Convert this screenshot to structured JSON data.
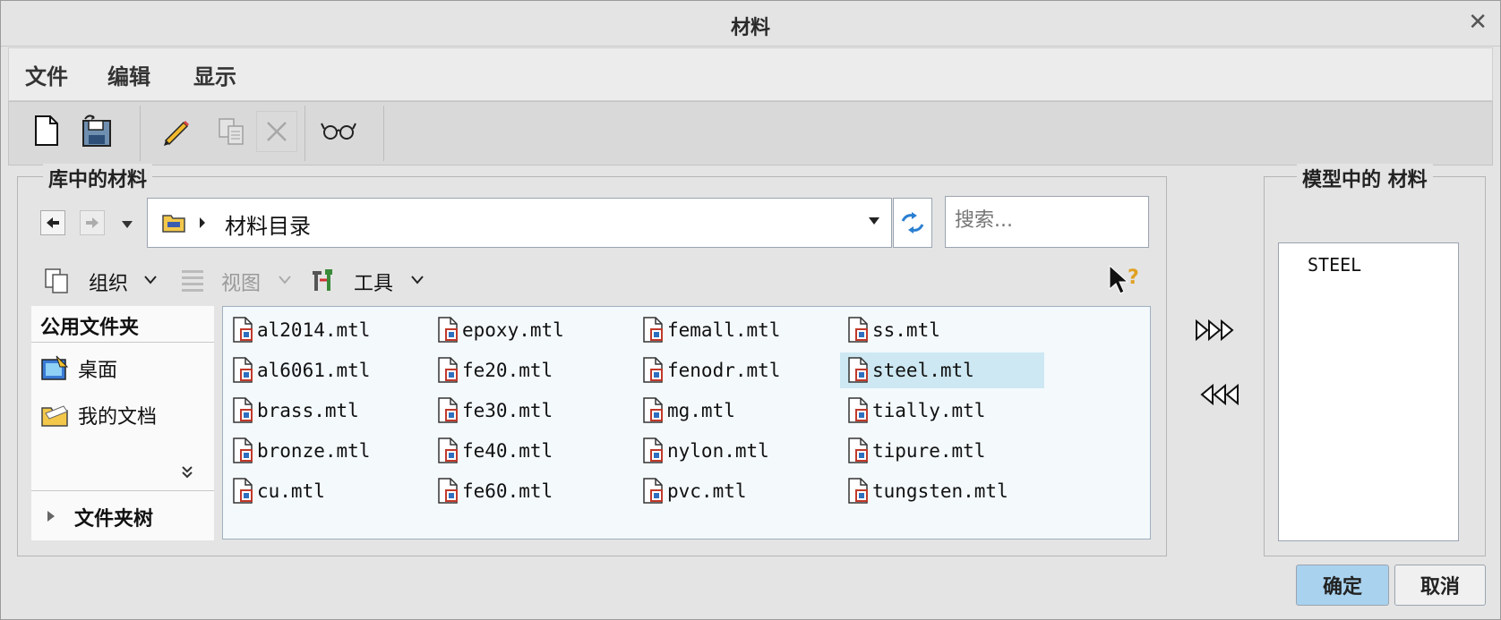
{
  "window": {
    "title": "材料"
  },
  "menu": [
    "文件",
    "编辑",
    "显示"
  ],
  "toolbar": {
    "buttons": [
      {
        "name": "new-icon",
        "enabled": true
      },
      {
        "name": "save-icon",
        "enabled": true
      },
      {
        "name": "pencil-edit-icon",
        "enabled": true
      },
      {
        "name": "copy-icon",
        "enabled": false
      },
      {
        "name": "delete-icon",
        "enabled": false
      },
      {
        "name": "glasses-view-icon",
        "enabled": true
      }
    ]
  },
  "library": {
    "legend": "库中的材料",
    "path": "材料目录",
    "search_placeholder": "搜索...",
    "organize": "组织",
    "view": "视图",
    "tools": "工具",
    "common_folders": "公用文件夹",
    "desktop": "桌面",
    "documents": "我的文档",
    "folder_tree": "文件夹树",
    "files": [
      "al2014.mtl",
      "epoxy.mtl",
      "femall.mtl",
      "ss.mtl",
      "al6061.mtl",
      "fe20.mtl",
      "fenodr.mtl",
      "steel.mtl",
      "brass.mtl",
      "fe30.mtl",
      "mg.mtl",
      "tially.mtl",
      "bronze.mtl",
      "fe40.mtl",
      "nylon.mtl",
      "tipure.mtl",
      "cu.mtl",
      "fe60.mtl",
      "pvc.mtl",
      "tungsten.mtl"
    ],
    "selected": "steel.mtl"
  },
  "model": {
    "legend": "模型中的 材料",
    "items": [
      "STEEL"
    ]
  },
  "buttons": {
    "ok": "确定",
    "cancel": "取消"
  }
}
